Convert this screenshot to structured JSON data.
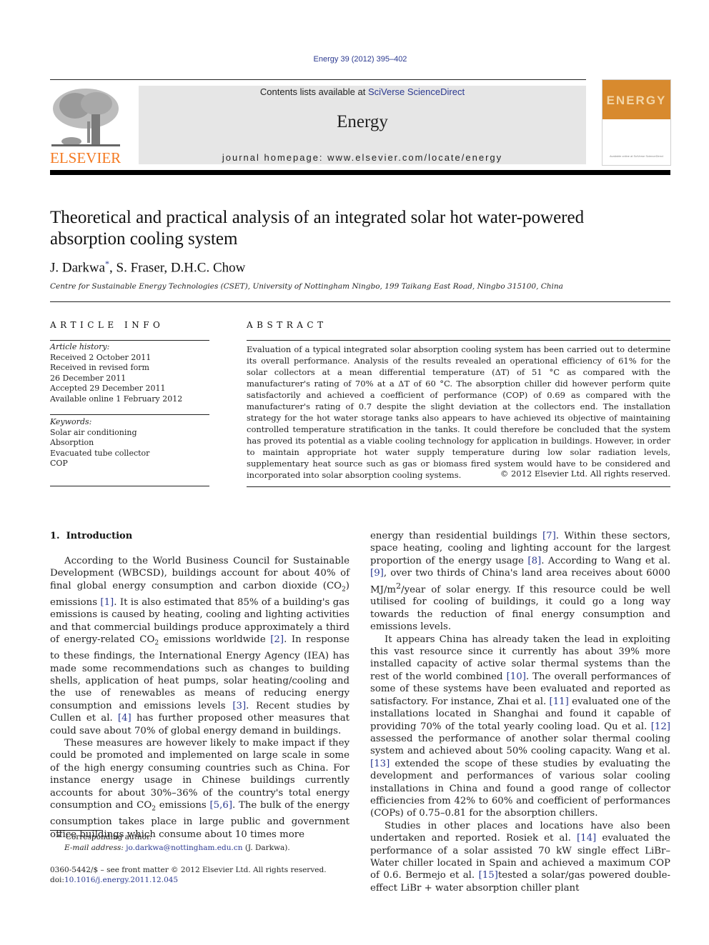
{
  "citation": "Energy 39 (2012) 395–402",
  "header": {
    "contents_prefix": "Contents lists available at ",
    "contents_link": "SciVerse ScienceDirect",
    "journal_name": "Energy",
    "homepage": "journal homepage: www.elsevier.com/locate/energy",
    "publisher_logo_text": "ELSEVIER",
    "cover_title": "ENERGY",
    "cover_footer": "Available online at SciVerse ScienceDirect"
  },
  "colors": {
    "link": "#2b3990",
    "elsevier_orange": "#f47920",
    "header_gray": "#e6e6e6",
    "cover_orange": "#d88a2e"
  },
  "article": {
    "title_line1": "Theoretical and practical analysis of an integrated solar hot water-powered",
    "title_line2": "absorption cooling system",
    "authors": [
      {
        "name": "J. Darkwa",
        "mark": "*"
      },
      {
        "name": "S. Fraser",
        "mark": ""
      },
      {
        "name": "D.H.C. Chow",
        "mark": ""
      }
    ],
    "affiliation": "Centre for Sustainable Energy Technologies (CSET), University of Nottingham Ningbo, 199 Taikang East Road, Ningbo 315100, China"
  },
  "article_info": {
    "heading": "ARTICLE INFO",
    "history_label": "Article history:",
    "history": [
      "Received 2 October 2011",
      "Received in revised form",
      "26 December 2011",
      "Accepted 29 December 2011",
      "Available online 1 February 2012"
    ],
    "keywords_label": "Keywords:",
    "keywords": [
      "Solar air conditioning",
      "Absorption",
      "Evacuated tube collector",
      "COP"
    ]
  },
  "abstract": {
    "heading": "ABSTRACT",
    "text": "Evaluation of a typical integrated solar absorption cooling system has been carried out to determine its overall performance. Analysis of the results revealed an operational efficiency of 61% for the solar collectors at a mean differential temperature (ΔT) of 51 °C as compared with the manufacturer's rating of 70% at a ΔT of 60 °C. The absorption chiller did however perform quite satisfactorily and achieved a coefficient of performance (COP) of 0.69 as compared with the manufacturer's rating of 0.7 despite the slight deviation at the collectors end. The installation strategy for the hot water storage tanks also appears to have achieved its objective of maintaining controlled temperature stratification in the tanks. It could therefore be concluded that the system has proved its potential as a viable cooling technology for application in buildings. However, in order to maintain appropriate hot water supply temperature during low solar radiation levels, supplementary heat source such as gas or biomass fired system would have to be considered and incorporated into solar absorption cooling systems.",
    "copyright": "© 2012 Elsevier Ltd. All rights reserved."
  },
  "section1": {
    "number": "1.",
    "title": "Introduction",
    "p1": [
      {
        "t": "According to the World Business Council for Sustainable Development (WBCSD), buildings account for about 40% of final global energy consumption and carbon dioxide (CO"
      },
      {
        "sub": "2"
      },
      {
        "t": ") emissions "
      },
      {
        "ref": "[1]"
      },
      {
        "t": ". It is also estimated that 85% of a building's gas emissions is caused by heating, cooling and lighting activities and that commercial buildings produce approximately a third of energy-related CO"
      },
      {
        "sub": "2"
      },
      {
        "t": " emissions worldwide "
      },
      {
        "ref": "[2]"
      },
      {
        "t": ". In response to these findings, the International Energy Agency (IEA) has made some recommendations such as changes to building shells, application of heat pumps, solar heating/cooling and the use of renewables as means of reducing energy consumption and emissions levels "
      },
      {
        "ref": "[3]"
      },
      {
        "t": ". Recent studies by Cullen et al. "
      },
      {
        "ref": "[4]"
      },
      {
        "t": " has further proposed other measures that could save about 70% of global energy demand in buildings."
      }
    ],
    "p2": [
      {
        "t": "These measures are however likely to make impact if they could be promoted and implemented on large scale in some of the high energy consuming countries such as China. For instance energy usage in Chinese buildings currently accounts for about 30%–36% of the country's total energy consumption and CO"
      },
      {
        "sub": "2"
      },
      {
        "t": " emissions "
      },
      {
        "ref": "[5,6]"
      },
      {
        "t": ". The bulk of the energy consumption takes place in large public and government office buildings which consume about 10 times more"
      }
    ],
    "p3": [
      {
        "t": "energy than residential buildings "
      },
      {
        "ref": "[7]"
      },
      {
        "t": ". Within these sectors, space heating, cooling and lighting account for the largest proportion of the energy usage "
      },
      {
        "ref": "[8]"
      },
      {
        "t": ". According to Wang et al. "
      },
      {
        "ref": "[9]"
      },
      {
        "t": ", over two thirds of China's land area receives about 6000 MJ/m"
      },
      {
        "sup": "2"
      },
      {
        "t": "/year of solar energy. If this resource could be well utilised for cooling of buildings, it could go a long way towards the reduction of final energy consumption and emissions levels."
      }
    ],
    "p4": [
      {
        "t": "It appears China has already taken the lead in exploiting this vast resource since it currently has about 39% more installed capacity of active solar thermal systems than the rest of the world combined "
      },
      {
        "ref": "[10]"
      },
      {
        "t": ". The overall performances of some of these systems have been evaluated and reported as satisfactory. For instance, Zhai et al. "
      },
      {
        "ref": "[11]"
      },
      {
        "t": " evaluated one of the installations located in Shanghai and found it capable of providing 70% of the total yearly cooling load. Qu et al. "
      },
      {
        "ref": "[12]"
      },
      {
        "t": " assessed the performance of another solar thermal cooling system and achieved about 50% cooling capacity. Wang et al. "
      },
      {
        "ref": "[13]"
      },
      {
        "t": " extended the scope of these studies by evaluating the development and performances of various solar cooling installations in China and found a good range of collector efficiencies from 42% to 60% and coefficient of performances (COPs) of 0.75–0.81 for the absorption chillers."
      }
    ],
    "p5": [
      {
        "t": "Studies in other places and locations have also been undertaken and reported. Rosiek et al. "
      },
      {
        "ref": "[14]"
      },
      {
        "t": " evaluated the performance of a solar assisted 70 kW single effect LiBr–Water chiller located in Spain and achieved a maximum COP of 0.6. Bermejo et al. "
      },
      {
        "ref": "[15]"
      },
      {
        "t": "tested a solar/gas powered double-effect LiBr + water absorption chiller plant"
      }
    ]
  },
  "footnotes": {
    "corresponding_mark": "*",
    "corresponding": "Corresponding author.",
    "email_label": "E-mail address:",
    "email": "jo.darkwa@nottingham.edu.cn",
    "email_suffix": " (J. Darkwa).",
    "front_matter": "0360-5442/$ – see front matter © 2012 Elsevier Ltd. All rights reserved.",
    "doi_label": "doi:",
    "doi": "10.1016/j.energy.2011.12.045"
  }
}
